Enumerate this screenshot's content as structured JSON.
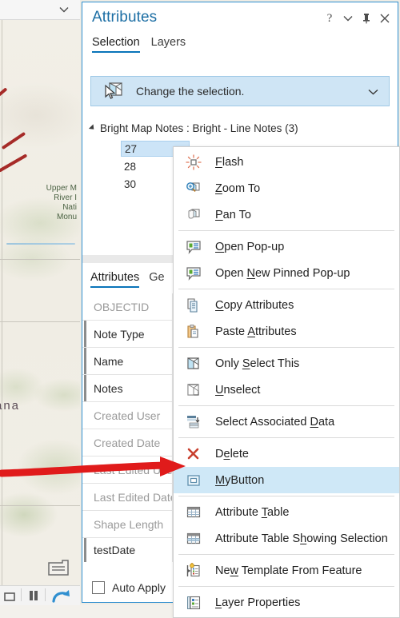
{
  "map": {
    "labels": [
      "Upper M",
      "River I",
      "Nati",
      "Monu"
    ],
    "state_label": "ana",
    "topbar_chevron": "chevron-down",
    "bookmark_icon": "bookmark-icon"
  },
  "pane": {
    "title": "Attributes",
    "buttons": [
      {
        "name": "help-button",
        "glyph": "?"
      },
      {
        "name": "menu-chevron-button",
        "glyph": "⌄"
      },
      {
        "name": "pin-button",
        "glyph": "pin"
      },
      {
        "name": "close-button",
        "glyph": "×"
      }
    ],
    "tabs": [
      {
        "label": "Selection",
        "active": true
      },
      {
        "label": "Layers",
        "active": false
      }
    ],
    "selection_bar": {
      "text": "Change the selection.",
      "icon": "select-features-icon",
      "chevron": "chevron-down"
    },
    "tree": {
      "root": "Bright Map Notes : Bright - Line Notes (3)",
      "children": [
        {
          "label": "27",
          "selected": true
        },
        {
          "label": "28",
          "selected": false
        },
        {
          "label": "30",
          "selected": false
        }
      ]
    },
    "lower_tabs": [
      {
        "label": "Attributes",
        "active": true
      },
      {
        "label": "Ge",
        "active": false
      }
    ],
    "fields": [
      {
        "name": "OBJECTID",
        "readonly": true,
        "accent": false
      },
      {
        "name": "Note Type",
        "readonly": false,
        "accent": true
      },
      {
        "name": "Name",
        "readonly": false,
        "accent": true
      },
      {
        "name": "Notes",
        "readonly": false,
        "accent": true
      },
      {
        "name": "Created User",
        "readonly": true,
        "accent": false
      },
      {
        "name": "Created Date",
        "readonly": true,
        "accent": false
      },
      {
        "name": "Last Edited Use",
        "readonly": true,
        "accent": false
      },
      {
        "name": "Last Edited Date",
        "readonly": true,
        "accent": false
      },
      {
        "name": "Shape Length",
        "readonly": true,
        "accent": false
      },
      {
        "name": "testDate",
        "readonly": false,
        "accent": true
      }
    ],
    "footer": {
      "auto_apply_label": "Auto Apply",
      "auto_apply_checked": false
    }
  },
  "context_menu": {
    "items": [
      {
        "label": "Flash",
        "accel": "F",
        "icon": "flash-icon",
        "highlight": false,
        "underline": true,
        "sep_after": false
      },
      {
        "label": "Zoom To",
        "accel": "Z",
        "icon": "zoom-to-icon",
        "highlight": false,
        "underline": true,
        "sep_after": false
      },
      {
        "label": "Pan To",
        "accel": "P",
        "icon": "pan-to-icon",
        "highlight": false,
        "underline": true,
        "sep_after": true
      },
      {
        "label": "Open Pop-up",
        "accel": "O",
        "icon": "popup-icon",
        "highlight": false,
        "underline": true,
        "sep_after": false
      },
      {
        "label": "Open New Pinned Pop-up",
        "accel": "N",
        "icon": "pinned-popup-icon",
        "highlight": false,
        "underline": true,
        "sep_after": true
      },
      {
        "label": "Copy Attributes",
        "accel": "C",
        "icon": "copy-icon",
        "highlight": false,
        "underline": true,
        "sep_after": false
      },
      {
        "label": "Paste Attributes",
        "accel": "A",
        "icon": "paste-icon",
        "highlight": false,
        "underline": true,
        "sep_after": true
      },
      {
        "label": "Only Select This",
        "accel": "S",
        "icon": "only-select-icon",
        "highlight": false,
        "underline": true,
        "sep_after": false
      },
      {
        "label": "Unselect",
        "accel": "U",
        "icon": "unselect-icon",
        "highlight": false,
        "underline": true,
        "sep_after": true
      },
      {
        "label": "Select Associated Data",
        "accel": "D",
        "icon": "select-associated-data-icon",
        "highlight": false,
        "underline": true,
        "sep_after": true
      },
      {
        "label": "Delete",
        "accel": "e",
        "icon": "delete-icon",
        "highlight": false,
        "underline": true,
        "sep_after": false
      },
      {
        "label": "MyButton",
        "accel": "M",
        "icon": "mybutton-icon",
        "highlight": true,
        "underline": true,
        "sep_after": true
      },
      {
        "label": "Attribute Table",
        "accel": "T",
        "icon": "attribute-table-icon",
        "highlight": false,
        "underline": true,
        "sep_after": false
      },
      {
        "label": "Attribute Table Showing Selection",
        "accel": "h",
        "icon": "attribute-table-selection-icon",
        "highlight": false,
        "underline": true,
        "sep_after": true
      },
      {
        "label": "New Template From Feature",
        "accel": "w",
        "icon": "new-template-icon",
        "highlight": false,
        "underline": true,
        "sep_after": true
      },
      {
        "label": "Layer Properties",
        "accel": "L",
        "icon": "layer-properties-icon",
        "highlight": false,
        "underline": true,
        "sep_after": false
      }
    ]
  },
  "colors": {
    "accent_blue": "#0a74b9",
    "title_blue": "#1c6ea4",
    "highlight_blue": "#cfe8f7",
    "selection_bar_blue": "#cfe5f5",
    "tree_selection_blue": "#cce4f7",
    "annotation_red": "#e01b1b",
    "delete_red": "#c8402f",
    "map_road_red": "#a62b28"
  }
}
